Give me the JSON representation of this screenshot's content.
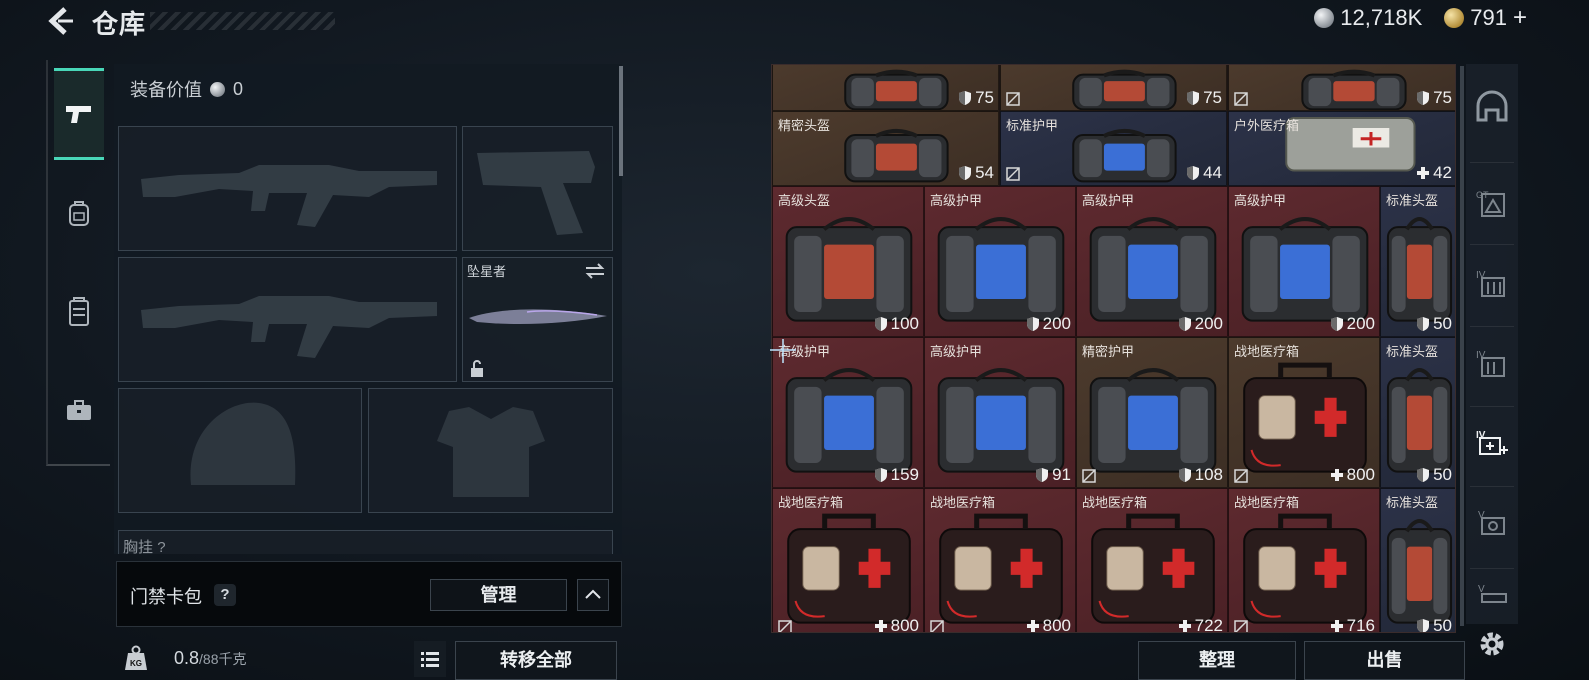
{
  "header": {
    "title": "仓库"
  },
  "currency": {
    "coins": "12,718K",
    "tokens": "791",
    "add_symbol": "+"
  },
  "left_tabs": [
    {
      "icon": "pistol-icon",
      "active": true
    },
    {
      "icon": "backpack-icon",
      "active": false
    },
    {
      "icon": "vest-icon",
      "active": false
    },
    {
      "icon": "briefcase-icon",
      "active": false
    }
  ],
  "loadout": {
    "equip_value_label": "装备价值",
    "equip_value": "0",
    "melee_name": "坠星者",
    "chest_label": "胸挂",
    "chest_count": "?"
  },
  "card_pack": {
    "label": "门禁卡包",
    "help": "?",
    "manage": "管理"
  },
  "weight": {
    "current": "0.8",
    "max": "/88",
    "unit": "千克",
    "icon_label": "KG"
  },
  "buttons": {
    "transfer_all": "转移全部",
    "sort": "整理",
    "sell": "出售"
  },
  "inventory": {
    "row0": [
      {
        "val": "75",
        "kind": "armor",
        "broken": false
      },
      {
        "val": "75",
        "kind": "armor",
        "broken": true
      },
      {
        "val": "75",
        "kind": "armor",
        "broken": true
      }
    ],
    "row1": [
      {
        "name": "精密头盔",
        "val": "54",
        "kind": "armor",
        "broken": false
      },
      {
        "name": "标准护甲",
        "val": "44",
        "kind": "armor",
        "broken": true
      },
      {
        "name": "户外医疗箱",
        "val": "42",
        "kind": "heal",
        "broken": false
      }
    ],
    "row2": [
      {
        "name": "高级头盔",
        "val": "100",
        "kind": "armor",
        "broken": false
      },
      {
        "name": "高级护甲",
        "val": "200",
        "kind": "armor",
        "broken": false
      },
      {
        "name": "高级护甲",
        "val": "200",
        "kind": "armor",
        "broken": false
      },
      {
        "name": "高级护甲",
        "val": "200",
        "kind": "armor",
        "broken": false
      },
      {
        "name": "标准头盔",
        "val": "50",
        "kind": "armor",
        "broken": false
      }
    ],
    "row3": [
      {
        "name": "高级护甲",
        "val": "159",
        "kind": "armor",
        "broken": false
      },
      {
        "name": "高级护甲",
        "val": "91",
        "kind": "armor",
        "broken": false
      },
      {
        "name": "精密护甲",
        "val": "108",
        "kind": "armor",
        "broken": true
      },
      {
        "name": "战地医疗箱",
        "val": "800",
        "kind": "heal",
        "broken": true
      },
      {
        "name": "标准头盔",
        "val": "50",
        "kind": "armor",
        "broken": false
      }
    ],
    "row4": [
      {
        "name": "战地医疗箱",
        "val": "800",
        "kind": "heal",
        "broken": true
      },
      {
        "name": "战地医疗箱",
        "val": "800",
        "kind": "heal",
        "broken": true
      },
      {
        "name": "战地医疗箱",
        "val": "722",
        "kind": "heal",
        "broken": false
      },
      {
        "name": "战地医疗箱",
        "val": "716",
        "kind": "heal",
        "broken": true
      },
      {
        "name": "标准头盔",
        "val": "50",
        "kind": "armor",
        "broken": false
      }
    ]
  },
  "rail": [
    {
      "icon": "helmet-category-icon",
      "label": ""
    },
    {
      "icon": "armor-category-icon",
      "label": "GT"
    },
    {
      "icon": "ammo-iv-category-icon",
      "label": "IV"
    },
    {
      "icon": "ammo-iv-category-icon-2",
      "label": "IV"
    },
    {
      "icon": "medical-iv-category-icon",
      "label": "IV"
    },
    {
      "icon": "v-category-icon",
      "label": "V"
    },
    {
      "icon": "v-category-icon-2",
      "label": "V"
    }
  ],
  "colors": {
    "accent": "#49d7b8",
    "cell_red": "#5e2a2f",
    "cell_brown": "#4d3b2d",
    "cell_blue": "#2c3248"
  }
}
